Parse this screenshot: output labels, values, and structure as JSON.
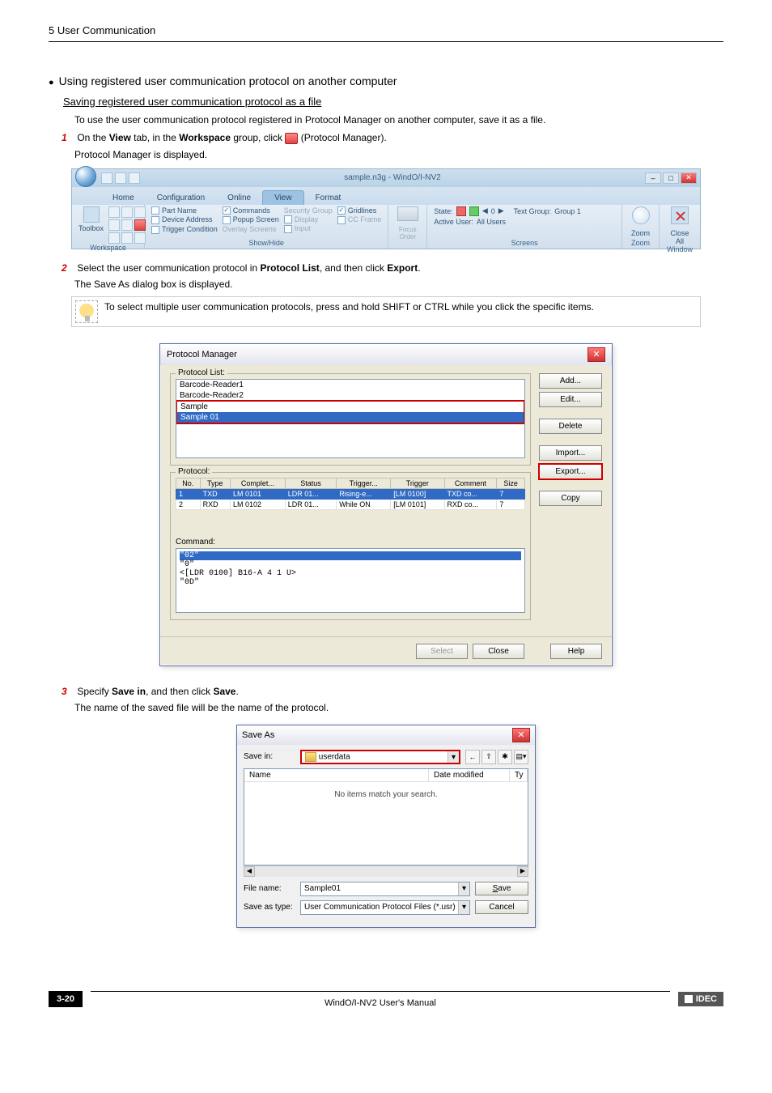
{
  "header": {
    "chapter": "5 User Communication"
  },
  "section": {
    "bullet_title": "Using registered user communication protocol on another computer",
    "sub_link": "Saving registered user communication protocol as a file",
    "intro": "To use the user communication protocol registered in Protocol Manager on another computer, save it as a file."
  },
  "steps": {
    "s1_pre": "On the ",
    "s1_view": "View",
    "s1_mid1": " tab, in the ",
    "s1_workspace": "Workspace",
    "s1_mid2": " group, click ",
    "s1_post": " (Protocol Manager).",
    "s1_l2": "Protocol Manager is displayed.",
    "s2_pre": "Select the user communication protocol in ",
    "s2_list": "Protocol List",
    "s2_mid": ", and then click ",
    "s2_export": "Export",
    "s2_post": ".",
    "s2_l2": "The Save As dialog box is displayed.",
    "s3_pre": "Specify ",
    "s3_savein": "Save in",
    "s3_mid": ", and then click ",
    "s3_save": "Save",
    "s3_post": ".",
    "s3_l2": "The name of the saved file will be the name of the protocol."
  },
  "tip": "To select multiple user communication protocols, press and hold SHIFT or CTRL while you click the specific items.",
  "ribbon": {
    "title": "sample.n3g - WindO/I-NV2",
    "tabs": [
      "Home",
      "Configuration",
      "Online",
      "View",
      "Format"
    ],
    "active_tab_idx": 3,
    "groups": {
      "workspace": "Workspace",
      "showhide": "Show/Hide",
      "screens": "Screens",
      "zoom_g": "Zoom",
      "window_g": "Window",
      "toolbox": "Toolbox",
      "partname": "Part Name",
      "devaddr": "Device Address",
      "trigcond": "Trigger Condition",
      "commands": "Commands",
      "popup": "Popup Screen",
      "overlay": "Overlay Screens",
      "secgroup": "Security Group",
      "display": "Display",
      "input": "Input",
      "gridlines": "Gridlines",
      "ccframe": "CC Frame",
      "focus": "Focus\nOrder",
      "state_l": "State:",
      "state_v": "0",
      "tg_l": "Text Group:",
      "tg_v": "Group 1",
      "au_l": "Active User:",
      "au_v": "All Users",
      "zoom": "Zoom",
      "closeall": "Close\nAll"
    }
  },
  "pm": {
    "title": "Protocol Manager",
    "list_label": "Protocol List:",
    "items": [
      "Barcode-Reader1",
      "Barcode-Reader2",
      "Sample",
      "Sample 01"
    ],
    "btns": {
      "add": "Add...",
      "edit": "Edit...",
      "delete": "Delete",
      "import": "Import...",
      "export": "Export...",
      "copy": "Copy"
    },
    "proto_label": "Protocol:",
    "cols": [
      "No.",
      "Type",
      "Complet...",
      "Status",
      "Trigger...",
      "Trigger",
      "Comment",
      "Size"
    ],
    "rows": [
      [
        "1",
        "TXD",
        "LM 0101",
        "LDR 01...",
        "Rising-e...",
        "[LM 0100]",
        "TXD co...",
        "7"
      ],
      [
        "2",
        "RXD",
        "LM 0102",
        "LDR 01...",
        "While ON",
        "[LM 0101]",
        "RXD co...",
        "7"
      ]
    ],
    "cmd_label": "Command:",
    "cmd_lines": [
      "\"02\"",
      "\"0\"",
      "<[LDR 0100] B16-A 4 1 U>",
      "\"0D\""
    ],
    "footer": {
      "select": "Select",
      "close": "Close",
      "help": "Help"
    }
  },
  "save": {
    "title": "Save As",
    "savein_l": "Save in:",
    "savein_v": "userdata",
    "col_name": "Name",
    "col_date": "Date modified",
    "col_ty": "Ty",
    "empty": "No items match your search.",
    "filename_l": "File name:",
    "filename_v": "Sample01",
    "type_l": "Save as type:",
    "type_v": "User Communication Protocol Files (*.usr)",
    "save_btn": "Save",
    "cancel_btn": "Cancel"
  },
  "footer": {
    "page": "3-20",
    "manual": "WindO/I-NV2 User's Manual",
    "brand": "IDEC"
  }
}
